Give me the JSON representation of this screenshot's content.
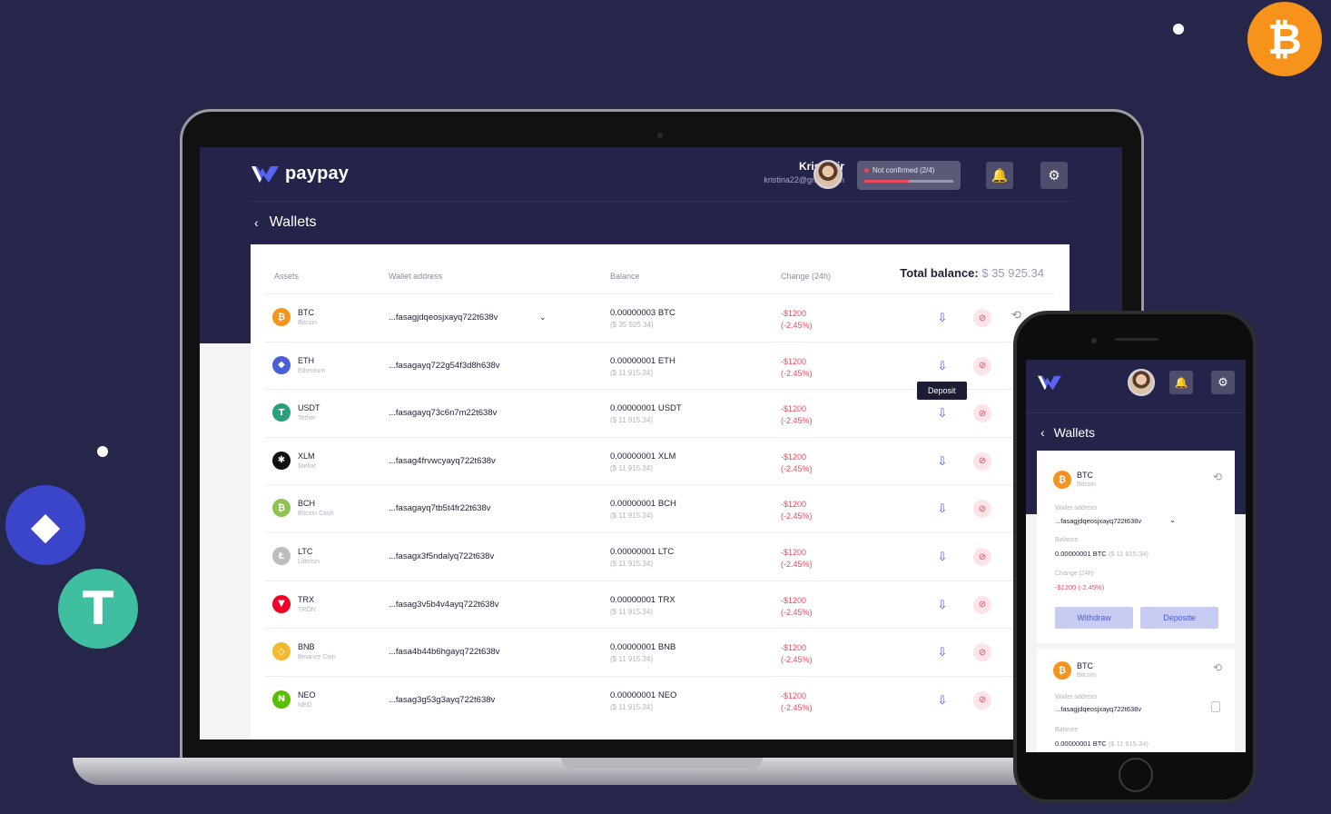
{
  "app": {
    "brand": "paypay"
  },
  "user": {
    "name": "Kris Spir",
    "email": "kristina22@gmail.com"
  },
  "verification": {
    "label": "Not confirmed (2/4)",
    "progress": 0.5
  },
  "page": {
    "title": "Wallets",
    "back_icon": "chevron-left-icon"
  },
  "table": {
    "headers": {
      "assets": "Assets",
      "address": "Wallet address",
      "balance": "Balance",
      "change": "Change (24h)"
    },
    "total_label": "Total balance:",
    "total_value": "$ 35 925.34",
    "rows": [
      {
        "symbol": "BTC",
        "name": "Bitcoin",
        "glyph": "₿",
        "color": "#f7931a",
        "address": "...fasagjdqeosjxayq722t638v",
        "balance": "0.00000003 BTC",
        "usd": "($ 35 925.34)",
        "change": "-$1200",
        "pct": "(-2.45%)",
        "has_dropdown": true
      },
      {
        "symbol": "ETH",
        "name": "Ethereum",
        "glyph": "◆",
        "color": "#4a5ed8",
        "address": "...fasagayq722g54f3d8h638v",
        "balance": "0.00000001 ETH",
        "usd": "($ 11 915.34)",
        "change": "-$1200",
        "pct": "(-2.45%)"
      },
      {
        "symbol": "USDT",
        "name": "Tether",
        "glyph": "T",
        "color": "#26a17b",
        "address": "...fasagayq73c6n7m22t638v",
        "balance": "0.00000001 USDT",
        "usd": "($ 11 915.34)",
        "change": "-$1200",
        "pct": "(-2.45%)"
      },
      {
        "symbol": "XLM",
        "name": "Stellar",
        "glyph": "✱",
        "color": "#111111",
        "address": "...fasag4frvwcyayq722t638v",
        "balance": "0.00000001 XLM",
        "usd": "($ 11 915.34)",
        "change": "-$1200",
        "pct": "(-2.45%)"
      },
      {
        "symbol": "BCH",
        "name": "Bitcoin Cash",
        "glyph": "₿",
        "color": "#8dc351",
        "address": "...fasagayq7tb5t4fr22t638v",
        "balance": "0.00000001 BCH",
        "usd": "($ 11 915.34)",
        "change": "-$1200",
        "pct": "(-2.45%)"
      },
      {
        "symbol": "LTC",
        "name": "Litecoin",
        "glyph": "Ł",
        "color": "#bebebe",
        "address": "...fasagx3f5ndalyq722t638v",
        "balance": "0.00000001 LTC",
        "usd": "($ 11 915.34)",
        "change": "-$1200",
        "pct": "(-2.45%)"
      },
      {
        "symbol": "TRX",
        "name": "TRON",
        "glyph": "▼",
        "color": "#ef0027",
        "address": "...fasag3v5b4v4ayq722t638v",
        "balance": "0.00000001 TRX",
        "usd": "($ 11 915.34)",
        "change": "-$1200",
        "pct": "(-2.45%)"
      },
      {
        "symbol": "BNB",
        "name": "Binance Coin",
        "glyph": "◇",
        "color": "#f3ba2f",
        "address": "...fasa4b44b6hgayq722t638v",
        "balance": "0.00000001 BNB",
        "usd": "($ 11 915.34)",
        "change": "-$1200",
        "pct": "(-2.45%)"
      },
      {
        "symbol": "NEO",
        "name": "NEO",
        "glyph": "N",
        "color": "#58bf00",
        "address": "...fasag3g53g3ayq722t638v",
        "balance": "0.00000001 NEO",
        "usd": "($ 11 915.34)",
        "change": "-$1200",
        "pct": "(-2.45%)"
      }
    ],
    "deposit_tooltip": "Deposit"
  },
  "mobile": {
    "title": "Wallets",
    "card1": {
      "symbol": "BTC",
      "name": "Bitcoin",
      "address_label": "Wallet address",
      "address": "...fasagjdqeosjxayq722t638v",
      "balance_label": "Balance",
      "balance": "0.00000001 BTC",
      "usd": "($ 11 915.34)",
      "change_label": "Change (24h)",
      "change": "-$1200 (-2.45%)",
      "withdraw": "Withdraw",
      "deposit": "Deposite"
    },
    "card2": {
      "symbol": "BTC",
      "name": "Bitcoin",
      "address_label": "Wallet address",
      "address": "...fasagjdqeosjxayq722t638v",
      "balance_label": "Balance",
      "balance": "0.00000001 BTC",
      "usd": "($ 11 915.34)"
    }
  },
  "colors": {
    "background": "#26264a",
    "accent": "#4a5ed8",
    "negative": "#e84a5f"
  }
}
